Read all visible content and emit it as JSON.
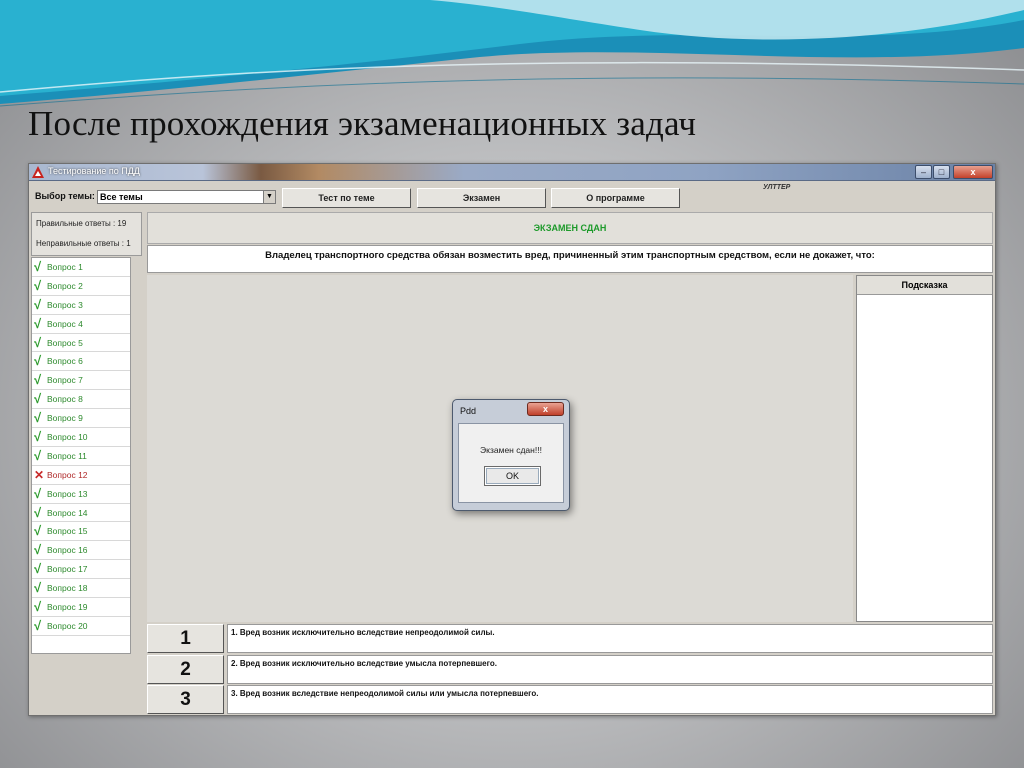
{
  "slide": {
    "title": "После прохождения экзаменационных задач"
  },
  "window": {
    "title": "Тестирование по ПДД",
    "controls": {
      "minimize": "–",
      "maximize": "□",
      "close": "x"
    }
  },
  "toolbar": {
    "topic_label": "Выбор темы:",
    "topic_value": "Все темы",
    "buttons": {
      "topic_test": "Тест по теме",
      "exam": "Экзамен",
      "about": "О программе"
    },
    "brand": "УЛТТЕР"
  },
  "stats": {
    "correct": "Правильные ответы   : 19",
    "incorrect": "Неправильные ответы : 1"
  },
  "questions": [
    {
      "label": "Вопрос 1",
      "status": "correct"
    },
    {
      "label": "Вопрос 2",
      "status": "correct"
    },
    {
      "label": "Вопрос 3",
      "status": "correct"
    },
    {
      "label": "Вопрос 4",
      "status": "correct"
    },
    {
      "label": "Вопрос 5",
      "status": "correct"
    },
    {
      "label": "Вопрос 6",
      "status": "correct"
    },
    {
      "label": "Вопрос 7",
      "status": "correct"
    },
    {
      "label": "Вопрос 8",
      "status": "correct"
    },
    {
      "label": "Вопрос 9",
      "status": "correct"
    },
    {
      "label": "Вопрос 10",
      "status": "correct"
    },
    {
      "label": "Вопрос 11",
      "status": "correct"
    },
    {
      "label": "Вопрос 12",
      "status": "wrong"
    },
    {
      "label": "Вопрос 13",
      "status": "correct"
    },
    {
      "label": "Вопрос 14",
      "status": "correct"
    },
    {
      "label": "Вопрос 15",
      "status": "correct"
    },
    {
      "label": "Вопрос 16",
      "status": "correct"
    },
    {
      "label": "Вопрос 17",
      "status": "correct"
    },
    {
      "label": "Вопрос 18",
      "status": "correct"
    },
    {
      "label": "Вопрос 19",
      "status": "correct"
    },
    {
      "label": "Вопрос 20",
      "status": "correct"
    }
  ],
  "marks": {
    "correct": "√",
    "wrong": "✕"
  },
  "status_text": "ЭКЗАМЕН СДАН",
  "question_text": "Владелец транспортного средства обязан возместить вред, причиненный этим транспортным средством, если не докажет, что:",
  "hint": {
    "title": "Подсказка"
  },
  "answers": [
    {
      "num": "1",
      "text": "1. Вред возник исключительно вследствие непреодолимой силы."
    },
    {
      "num": "2",
      "text": "2. Вред возник исключительно вследствие умысла потерпевшего."
    },
    {
      "num": "3",
      "text": "3. Вред возник вследствие непреодолимой силы или умысла потерпевшего."
    }
  ],
  "dialog": {
    "title": "Pdd",
    "message": "Экзамен сдан!!!",
    "ok": "OK",
    "close": "x"
  },
  "colors": {
    "pass_green": "#1d9a2a",
    "wrong_red": "#c82a2a",
    "wave_teal": "#2bb0c9"
  }
}
